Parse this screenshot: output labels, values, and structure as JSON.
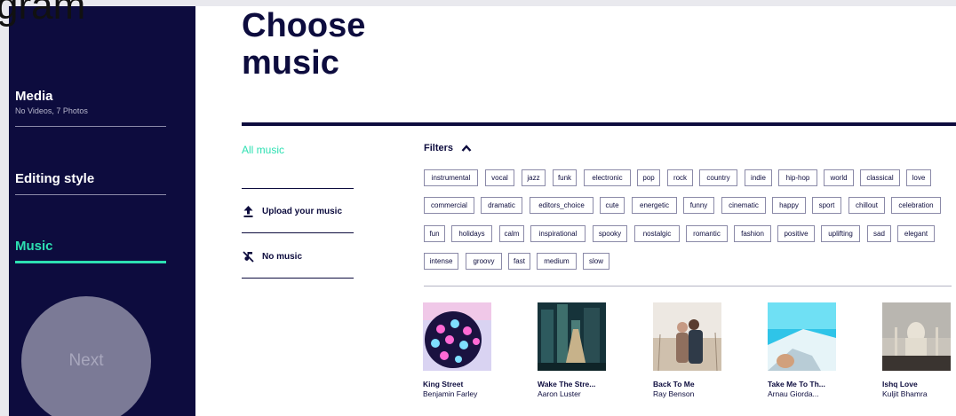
{
  "overlay_text": "gram",
  "sidebar": {
    "items": [
      {
        "label": "Media",
        "sub": "No Videos, 7 Photos"
      },
      {
        "label": "Editing style"
      },
      {
        "label": "Music"
      }
    ],
    "next_label": "Next"
  },
  "main": {
    "title_line1": "Choose",
    "title_line2": "music",
    "categories": {
      "all": "All music",
      "upload": "Upload your music",
      "none": "No music"
    },
    "filters_label": "Filters",
    "tags": [
      "instrumental",
      "vocal",
      "jazz",
      "funk",
      "electronic",
      "pop",
      "rock",
      "country",
      "indie",
      "hip-hop",
      "world",
      "classical",
      "love",
      "commercial",
      "dramatic",
      "editors_choice",
      "cute",
      "energetic",
      "funny",
      "cinematic",
      "happy",
      "sport",
      "chillout",
      "celebration",
      "fun",
      "holidays",
      "calm",
      "inspirational",
      "spooky",
      "nostalgic",
      "romantic",
      "fashion",
      "positive",
      "uplifting",
      "sad",
      "elegant",
      "intense",
      "groovy",
      "fast",
      "medium",
      "slow"
    ],
    "tracks": [
      {
        "title": "King Street",
        "artist": "Benjamin Farley"
      },
      {
        "title": "Wake The Stre...",
        "artist": "Aaron Luster"
      },
      {
        "title": "Back To Me",
        "artist": "Ray Benson"
      },
      {
        "title": "Take Me To Th...",
        "artist": "Arnau Giorda..."
      },
      {
        "title": "Ishq Love",
        "artist": "Kuljit Bhamra"
      }
    ]
  },
  "colors": {
    "navy": "#0d0c3e",
    "accent": "#2de0b2",
    "next_button": "#7b7a96"
  },
  "icons": {
    "upload": "upload-icon",
    "no_music": "no-music-icon",
    "filters_toggle": "chevron-up-icon"
  }
}
